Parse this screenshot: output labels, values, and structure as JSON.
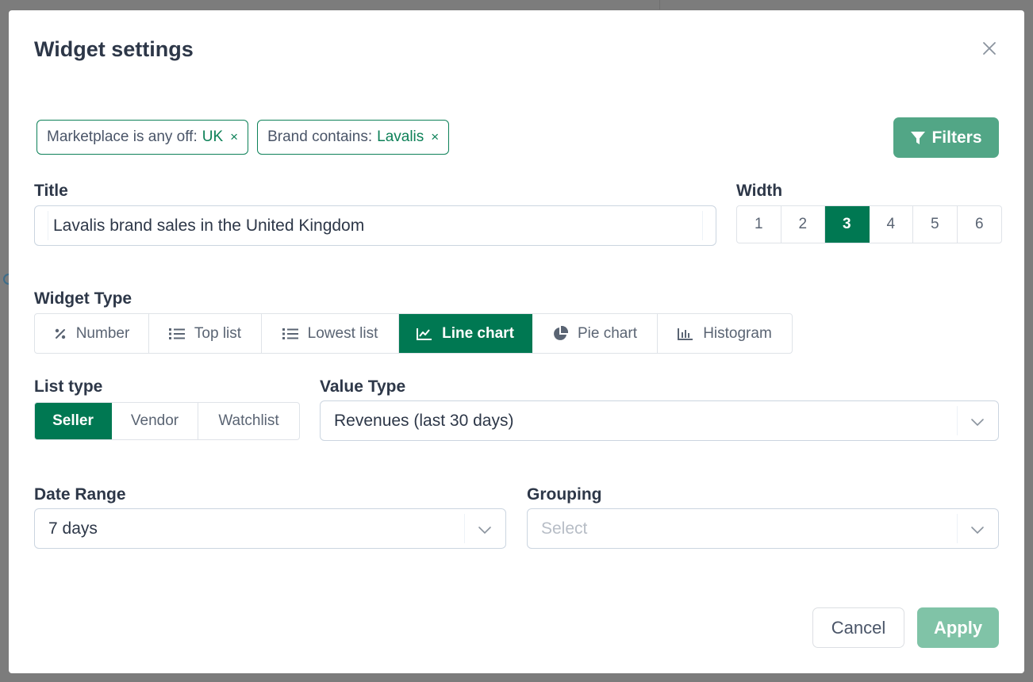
{
  "modal": {
    "title": "Widget settings"
  },
  "filters": {
    "chips": [
      {
        "label": "Marketplace is any off:",
        "value": "UK",
        "remove": "×"
      },
      {
        "label": "Brand contains:",
        "value": "Lavalis",
        "remove": "×"
      }
    ],
    "button_label": "Filters"
  },
  "title_field": {
    "label": "Title",
    "value": "Lavalis brand sales in the United Kingdom"
  },
  "width": {
    "label": "Width",
    "options": [
      "1",
      "2",
      "3",
      "4",
      "5",
      "6"
    ],
    "selected": "3"
  },
  "widget_type": {
    "label": "Widget Type",
    "options": [
      {
        "label": "Number",
        "icon": "percent-icon"
      },
      {
        "label": "Top list",
        "icon": "list-icon"
      },
      {
        "label": "Lowest list",
        "icon": "list-icon"
      },
      {
        "label": "Line chart",
        "icon": "line-chart-icon"
      },
      {
        "label": "Pie chart",
        "icon": "pie-chart-icon"
      },
      {
        "label": "Histogram",
        "icon": "bar-chart-icon"
      }
    ],
    "selected": "Line chart"
  },
  "list_type": {
    "label": "List type",
    "options": [
      "Seller",
      "Vendor",
      "Watchlist"
    ],
    "selected": "Seller"
  },
  "value_type": {
    "label": "Value Type",
    "value": "Revenues (last 30 days)"
  },
  "date_range": {
    "label": "Date Range",
    "value": "7 days"
  },
  "grouping": {
    "label": "Grouping",
    "placeholder": "Select"
  },
  "actions": {
    "cancel_label": "Cancel",
    "apply_label": "Apply"
  },
  "colors": {
    "accent": "#007852",
    "filters_button": "#52a686",
    "apply_disabled": "#80c3a7",
    "overlay": "#7c7c7c"
  }
}
